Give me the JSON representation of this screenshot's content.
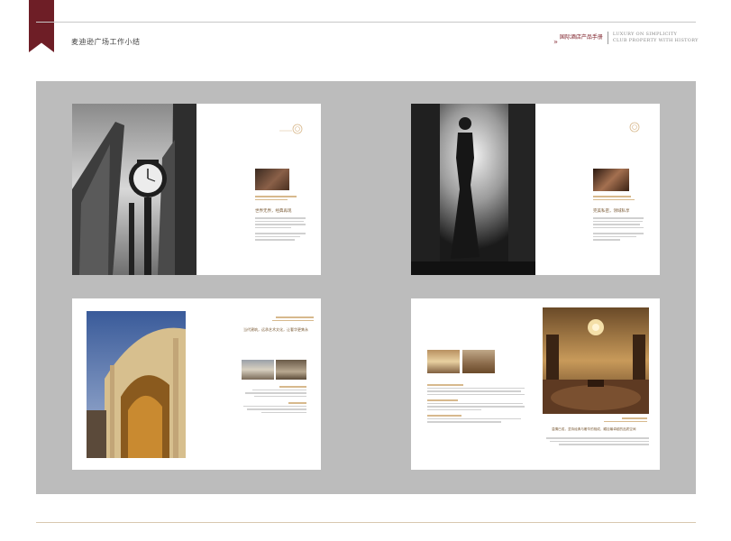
{
  "header": {
    "doc_title": "麦迪逊广场工作小结",
    "brand_cn": "国际酒店产品手册",
    "brand_en_line1": "LUXURY ON SIMPLICITY",
    "brand_en_line2": "CLUB PROPERTY WITH HISTORY"
  },
  "spreads": [
    {
      "headline": "世界无界，经典再现"
    },
    {
      "headline": "完美私密，领域私享"
    },
    {
      "headline": "当代建筑，远承艺术文化，让奢华更隽永"
    },
    {
      "headline": "温情已成，坚持经典与奢华的相成，瞩目最卓越的品质空间"
    }
  ],
  "colors": {
    "accent": "#6e1e26",
    "gold": "#b3894a",
    "stage": "#bcbcbc"
  }
}
